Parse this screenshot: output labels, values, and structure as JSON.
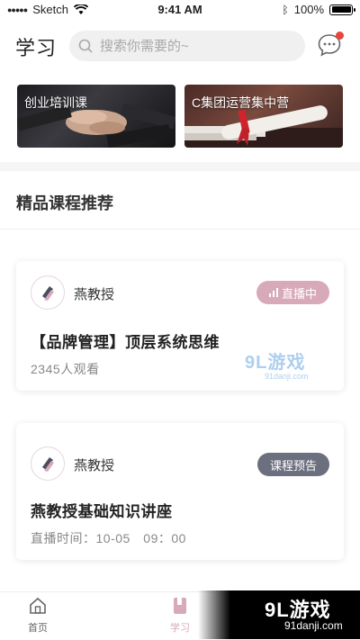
{
  "status_bar": {
    "carrier": "Sketch",
    "time": "9:41 AM",
    "battery": "100%"
  },
  "header": {
    "title": "学习",
    "search_placeholder": "搜索你需要的~"
  },
  "banners": [
    {
      "label": "创业培训课"
    },
    {
      "label": "C集团运营集中营"
    }
  ],
  "section": {
    "title": "精品课程推荐"
  },
  "courses": [
    {
      "teacher": "燕教授",
      "badge": "直播中",
      "title": "【品牌管理】顶层系统思维",
      "meta": "2345人观看",
      "badge_color": "#d8aab9"
    },
    {
      "teacher": "燕教授",
      "badge": "课程预告",
      "title": "燕教授基础知识讲座",
      "meta": "直播时间：10-05　09：00",
      "badge_color": "#6b6f7e"
    }
  ],
  "tabbar": {
    "items": [
      {
        "label": "首页"
      },
      {
        "label": "学习"
      }
    ]
  },
  "watermark": {
    "brand": "9L游戏",
    "site": "91danji.com"
  },
  "colors": {
    "accent": "#d8aab9",
    "notification": "#e8453c"
  }
}
